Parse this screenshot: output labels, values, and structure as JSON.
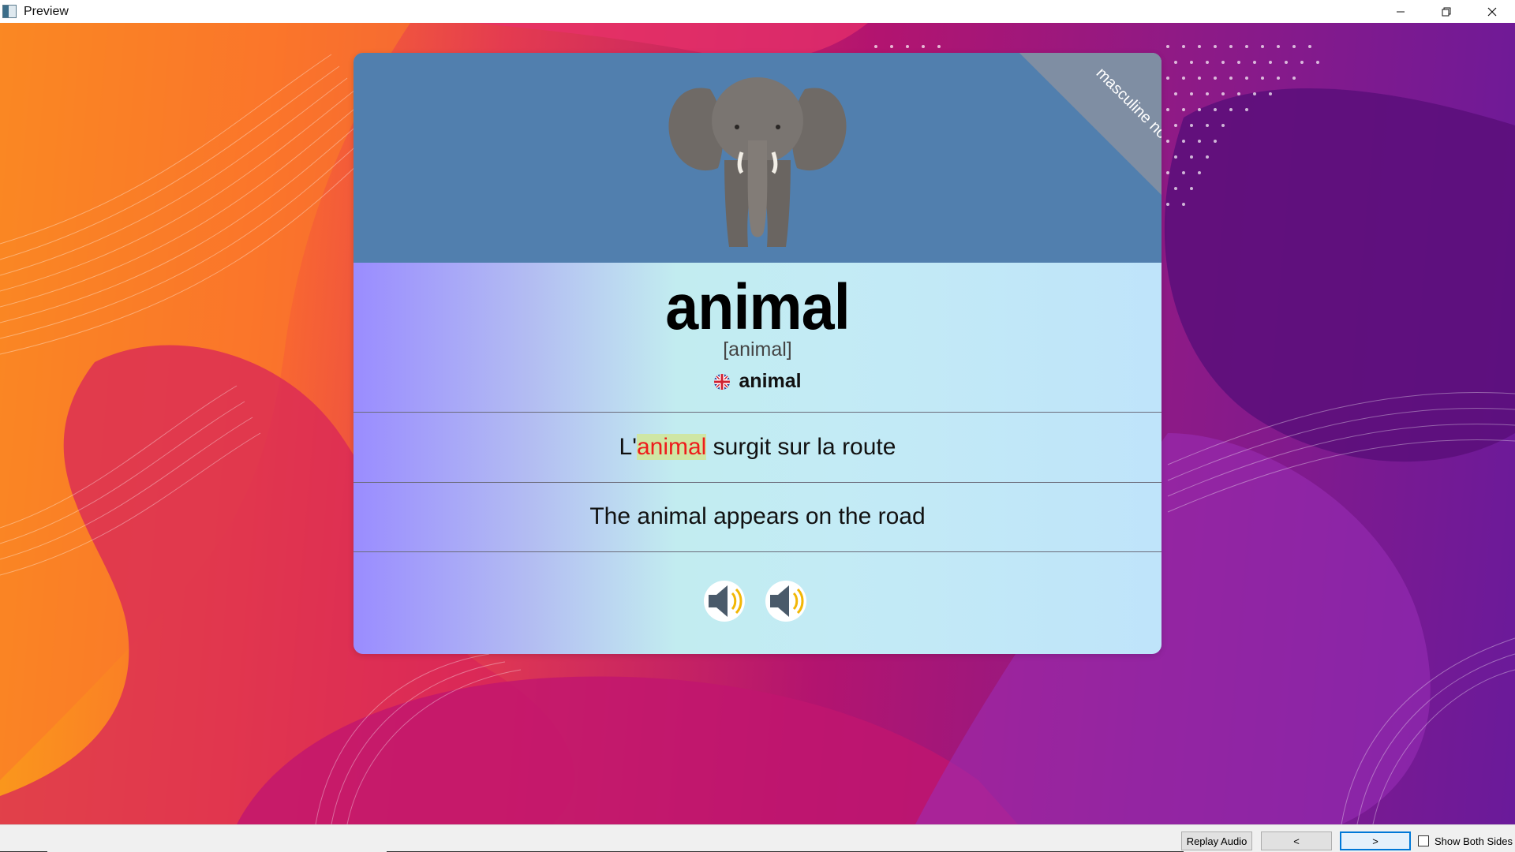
{
  "window": {
    "title": "Preview"
  },
  "card": {
    "gender_tag": "masculine noun",
    "word": "animal",
    "phonetic": "[animal]",
    "translation": "animal",
    "translation_flag": "uk-flag-icon",
    "sentence": {
      "before": "L'",
      "highlight": "animal",
      "after": " surgit sur la route"
    },
    "sentence_translation": "The animal appears on the road",
    "image": "elephant",
    "audio_buttons": [
      "speaker-icon",
      "speaker-icon"
    ]
  },
  "bottom": {
    "replay_audio": "Replay Audio",
    "prev": "<",
    "next": ">",
    "show_both_sides": "Show Both Sides",
    "show_both_sides_checked": false
  },
  "colors": {
    "card_header": "#517fae",
    "highlight_text": "#ee1c1c",
    "highlight_bg": "#cfe6a4",
    "active_button_border": "#0078d7"
  }
}
